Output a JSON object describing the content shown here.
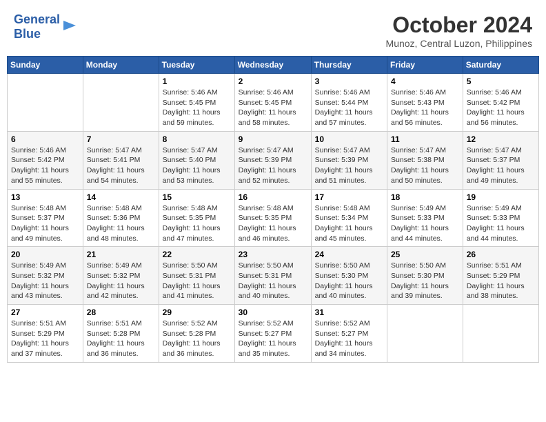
{
  "header": {
    "logo_line1": "General",
    "logo_line2": "Blue",
    "month": "October 2024",
    "location": "Munoz, Central Luzon, Philippines"
  },
  "weekdays": [
    "Sunday",
    "Monday",
    "Tuesday",
    "Wednesday",
    "Thursday",
    "Friday",
    "Saturday"
  ],
  "weeks": [
    [
      {
        "day": "",
        "content": ""
      },
      {
        "day": "",
        "content": ""
      },
      {
        "day": "1",
        "content": "Sunrise: 5:46 AM\nSunset: 5:45 PM\nDaylight: 11 hours and 59 minutes."
      },
      {
        "day": "2",
        "content": "Sunrise: 5:46 AM\nSunset: 5:45 PM\nDaylight: 11 hours and 58 minutes."
      },
      {
        "day": "3",
        "content": "Sunrise: 5:46 AM\nSunset: 5:44 PM\nDaylight: 11 hours and 57 minutes."
      },
      {
        "day": "4",
        "content": "Sunrise: 5:46 AM\nSunset: 5:43 PM\nDaylight: 11 hours and 56 minutes."
      },
      {
        "day": "5",
        "content": "Sunrise: 5:46 AM\nSunset: 5:42 PM\nDaylight: 11 hours and 56 minutes."
      }
    ],
    [
      {
        "day": "6",
        "content": "Sunrise: 5:46 AM\nSunset: 5:42 PM\nDaylight: 11 hours and 55 minutes."
      },
      {
        "day": "7",
        "content": "Sunrise: 5:47 AM\nSunset: 5:41 PM\nDaylight: 11 hours and 54 minutes."
      },
      {
        "day": "8",
        "content": "Sunrise: 5:47 AM\nSunset: 5:40 PM\nDaylight: 11 hours and 53 minutes."
      },
      {
        "day": "9",
        "content": "Sunrise: 5:47 AM\nSunset: 5:39 PM\nDaylight: 11 hours and 52 minutes."
      },
      {
        "day": "10",
        "content": "Sunrise: 5:47 AM\nSunset: 5:39 PM\nDaylight: 11 hours and 51 minutes."
      },
      {
        "day": "11",
        "content": "Sunrise: 5:47 AM\nSunset: 5:38 PM\nDaylight: 11 hours and 50 minutes."
      },
      {
        "day": "12",
        "content": "Sunrise: 5:47 AM\nSunset: 5:37 PM\nDaylight: 11 hours and 49 minutes."
      }
    ],
    [
      {
        "day": "13",
        "content": "Sunrise: 5:48 AM\nSunset: 5:37 PM\nDaylight: 11 hours and 49 minutes."
      },
      {
        "day": "14",
        "content": "Sunrise: 5:48 AM\nSunset: 5:36 PM\nDaylight: 11 hours and 48 minutes."
      },
      {
        "day": "15",
        "content": "Sunrise: 5:48 AM\nSunset: 5:35 PM\nDaylight: 11 hours and 47 minutes."
      },
      {
        "day": "16",
        "content": "Sunrise: 5:48 AM\nSunset: 5:35 PM\nDaylight: 11 hours and 46 minutes."
      },
      {
        "day": "17",
        "content": "Sunrise: 5:48 AM\nSunset: 5:34 PM\nDaylight: 11 hours and 45 minutes."
      },
      {
        "day": "18",
        "content": "Sunrise: 5:49 AM\nSunset: 5:33 PM\nDaylight: 11 hours and 44 minutes."
      },
      {
        "day": "19",
        "content": "Sunrise: 5:49 AM\nSunset: 5:33 PM\nDaylight: 11 hours and 44 minutes."
      }
    ],
    [
      {
        "day": "20",
        "content": "Sunrise: 5:49 AM\nSunset: 5:32 PM\nDaylight: 11 hours and 43 minutes."
      },
      {
        "day": "21",
        "content": "Sunrise: 5:49 AM\nSunset: 5:32 PM\nDaylight: 11 hours and 42 minutes."
      },
      {
        "day": "22",
        "content": "Sunrise: 5:50 AM\nSunset: 5:31 PM\nDaylight: 11 hours and 41 minutes."
      },
      {
        "day": "23",
        "content": "Sunrise: 5:50 AM\nSunset: 5:31 PM\nDaylight: 11 hours and 40 minutes."
      },
      {
        "day": "24",
        "content": "Sunrise: 5:50 AM\nSunset: 5:30 PM\nDaylight: 11 hours and 40 minutes."
      },
      {
        "day": "25",
        "content": "Sunrise: 5:50 AM\nSunset: 5:30 PM\nDaylight: 11 hours and 39 minutes."
      },
      {
        "day": "26",
        "content": "Sunrise: 5:51 AM\nSunset: 5:29 PM\nDaylight: 11 hours and 38 minutes."
      }
    ],
    [
      {
        "day": "27",
        "content": "Sunrise: 5:51 AM\nSunset: 5:29 PM\nDaylight: 11 hours and 37 minutes."
      },
      {
        "day": "28",
        "content": "Sunrise: 5:51 AM\nSunset: 5:28 PM\nDaylight: 11 hours and 36 minutes."
      },
      {
        "day": "29",
        "content": "Sunrise: 5:52 AM\nSunset: 5:28 PM\nDaylight: 11 hours and 36 minutes."
      },
      {
        "day": "30",
        "content": "Sunrise: 5:52 AM\nSunset: 5:27 PM\nDaylight: 11 hours and 35 minutes."
      },
      {
        "day": "31",
        "content": "Sunrise: 5:52 AM\nSunset: 5:27 PM\nDaylight: 11 hours and 34 minutes."
      },
      {
        "day": "",
        "content": ""
      },
      {
        "day": "",
        "content": ""
      }
    ]
  ]
}
